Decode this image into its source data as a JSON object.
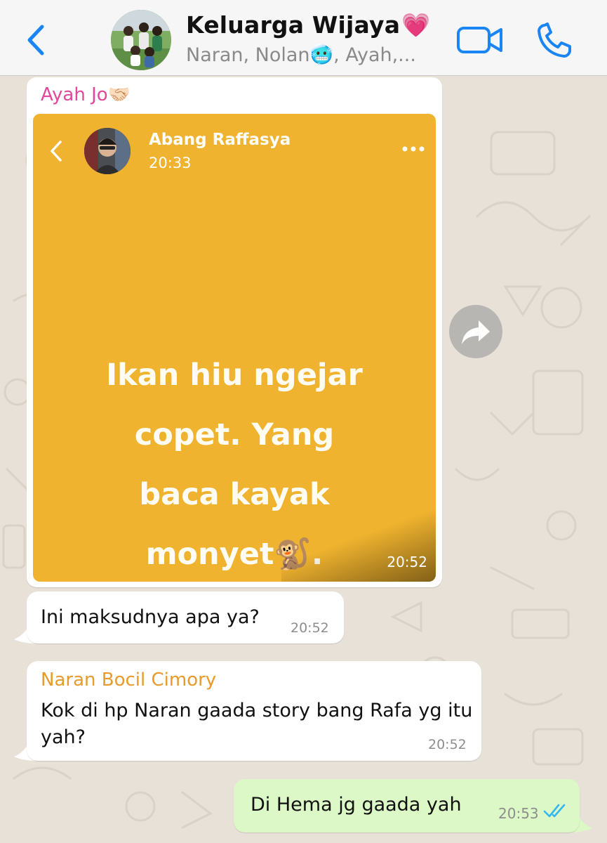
{
  "header": {
    "title": "Keluarga Wijaya",
    "title_emoji": "💗",
    "members": "Naran, Nolan🥶, Ayah,...",
    "back_icon": "chevron-left-icon",
    "video_icon": "video-camera-icon",
    "call_icon": "phone-icon",
    "accent_color": "#1a86f5"
  },
  "messages": [
    {
      "sender": "Ayah Jo🤝🏻",
      "sender_color": "#e0489b",
      "status_card": {
        "poster": "Abang Raffasya",
        "posted_time": "20:33",
        "text_lines": [
          "Ikan hiu ngejar",
          "copet. Yang",
          "baca kayak",
          "monyet🐒."
        ],
        "background_color": "#efb32f"
      },
      "time": "20:52"
    },
    {
      "text": "Ini maksudnya apa ya?",
      "time": "20:52"
    },
    {
      "sender": "Naran Bocil Cimory",
      "sender_color": "#e99a2c",
      "text": "Kok di hp Naran gaada story bang Rafa yg itu yah?",
      "time": "20:52"
    },
    {
      "text": "Di Hema jg gaada yah",
      "time": "20:53",
      "outgoing": true,
      "status": "read"
    }
  ]
}
